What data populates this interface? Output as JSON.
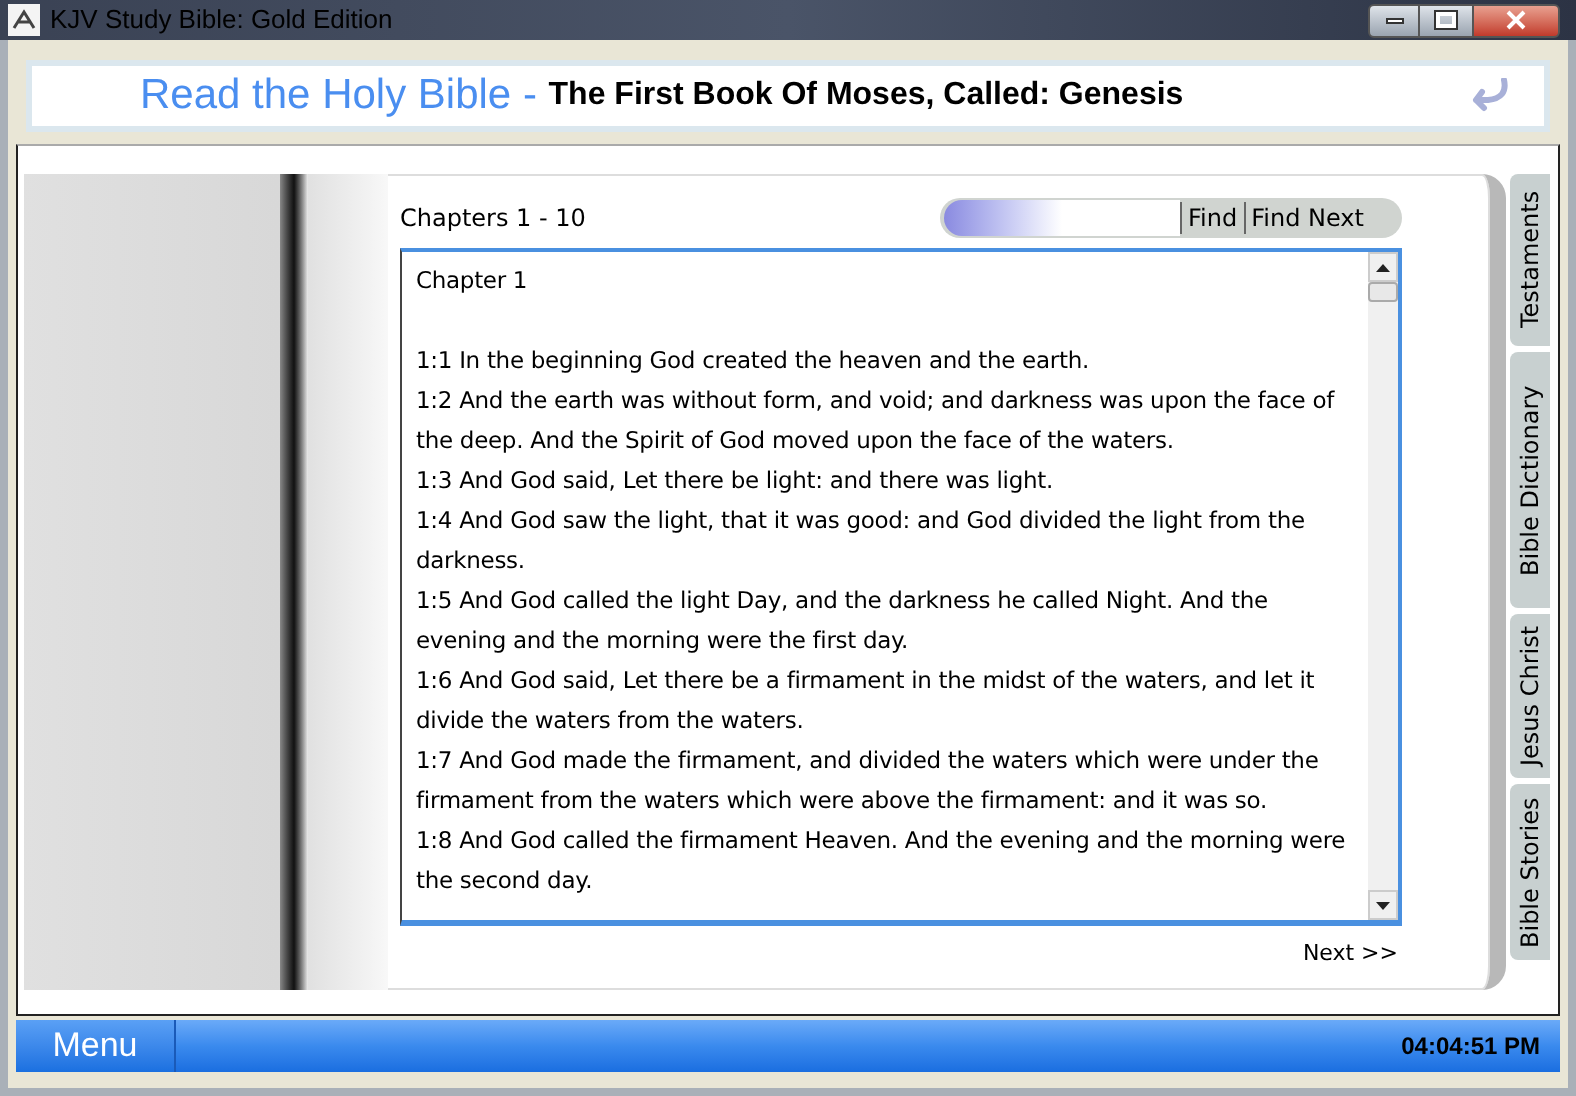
{
  "window": {
    "title": "KJV Study Bible: Gold Edition"
  },
  "header": {
    "title": "Read the Holy Bible - ",
    "subtitle": "The First Book Of Moses, Called: Genesis"
  },
  "reader": {
    "range": "Chapters 1 - 10",
    "find_button": "Find",
    "find_next_button": "Find Next",
    "chapter_heading": "Chapter 1",
    "verses": [
      "1:1 In the beginning God created the heaven and the earth.",
      "1:2 And the earth was without form, and void; and darkness was upon the face of the deep. And the Spirit of God moved upon the face of the waters.",
      "1:3 And God said, Let there be light: and there was light.",
      "1:4 And God saw the light, that it was good: and God divided the light from the darkness.",
      "1:5 And God called the light Day, and the darkness he called Night. And the evening and the morning were the first day.",
      "1:6 And God said, Let there be a firmament in the midst of the waters, and let it divide the waters from the waters.",
      "1:7 And God made the firmament, and divided the waters which were under the firmament from the waters which were above the firmament: and it was so.",
      "1:8 And God called the firmament Heaven. And the evening and the morning were the second day."
    ],
    "next": "Next >>"
  },
  "side_tabs": [
    {
      "label": "Testaments"
    },
    {
      "label": "Bible Dictionary"
    },
    {
      "label": "Jesus Christ"
    },
    {
      "label": "Bible Stories"
    }
  ],
  "bottom_bar": {
    "menu": "Menu",
    "clock": "04:04:51 PM"
  }
}
